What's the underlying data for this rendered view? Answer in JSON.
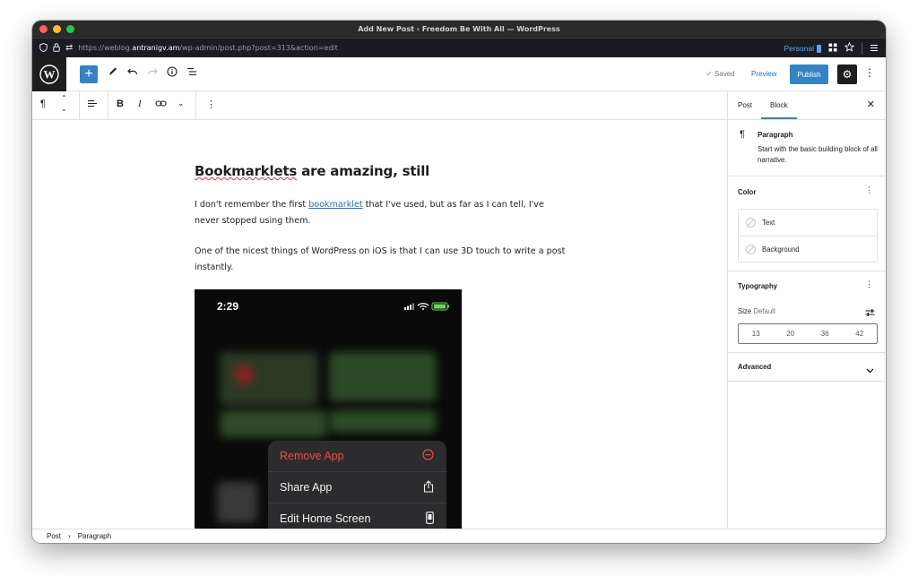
{
  "window": {
    "title": "Add New Post ‹ Freedom Be With All — WordPress",
    "traffic_colors": [
      "#ff5f57",
      "#febc2e",
      "#28c840"
    ]
  },
  "browser": {
    "url_prefix": "https://weblog.",
    "url_domain": "antranigv.am",
    "url_path": "/wp-admin/post.php?post=313&action=edit",
    "container_label": "Personal"
  },
  "header": {
    "saved_label": "Saved",
    "preview_label": "Preview",
    "publish_label": "Publish"
  },
  "post": {
    "title_word1": "Bookmarklets",
    "title_rest": " are amazing, still",
    "para1_before": "I don't remember the first ",
    "para1_link": "bookmarklet",
    "para1_after": " that I've used, but as far as I can tell, I've never stopped using them.",
    "para2": "One of the nicest things of WordPress on iOS is that I can use 3D touch to write a post instantly."
  },
  "phone": {
    "time": "2:29",
    "menu_items": [
      {
        "label": "Remove App",
        "icon": "minus-circle-icon"
      },
      {
        "label": "Share App",
        "icon": "share-icon"
      },
      {
        "label": "Edit Home Screen",
        "icon": "phone-icon"
      }
    ]
  },
  "sidebar": {
    "tab_post": "Post",
    "tab_block": "Block",
    "block_name": "Paragraph",
    "block_desc": "Start with the basic building block of all narrative.",
    "color_heading": "Color",
    "color_text": "Text",
    "color_background": "Background",
    "typography_heading": "Typography",
    "size_label": "Size",
    "size_value": "Default",
    "font_sizes": [
      "13",
      "20",
      "36",
      "42"
    ],
    "advanced_heading": "Advanced"
  },
  "footer": {
    "crumb_post": "Post",
    "crumb_sep": "›",
    "crumb_paragraph": "Paragraph"
  },
  "colors": {
    "accent": "#3582c4",
    "dark": "#1e1e1e",
    "link": "#2271b1",
    "destructive": "#ef4a3f"
  }
}
